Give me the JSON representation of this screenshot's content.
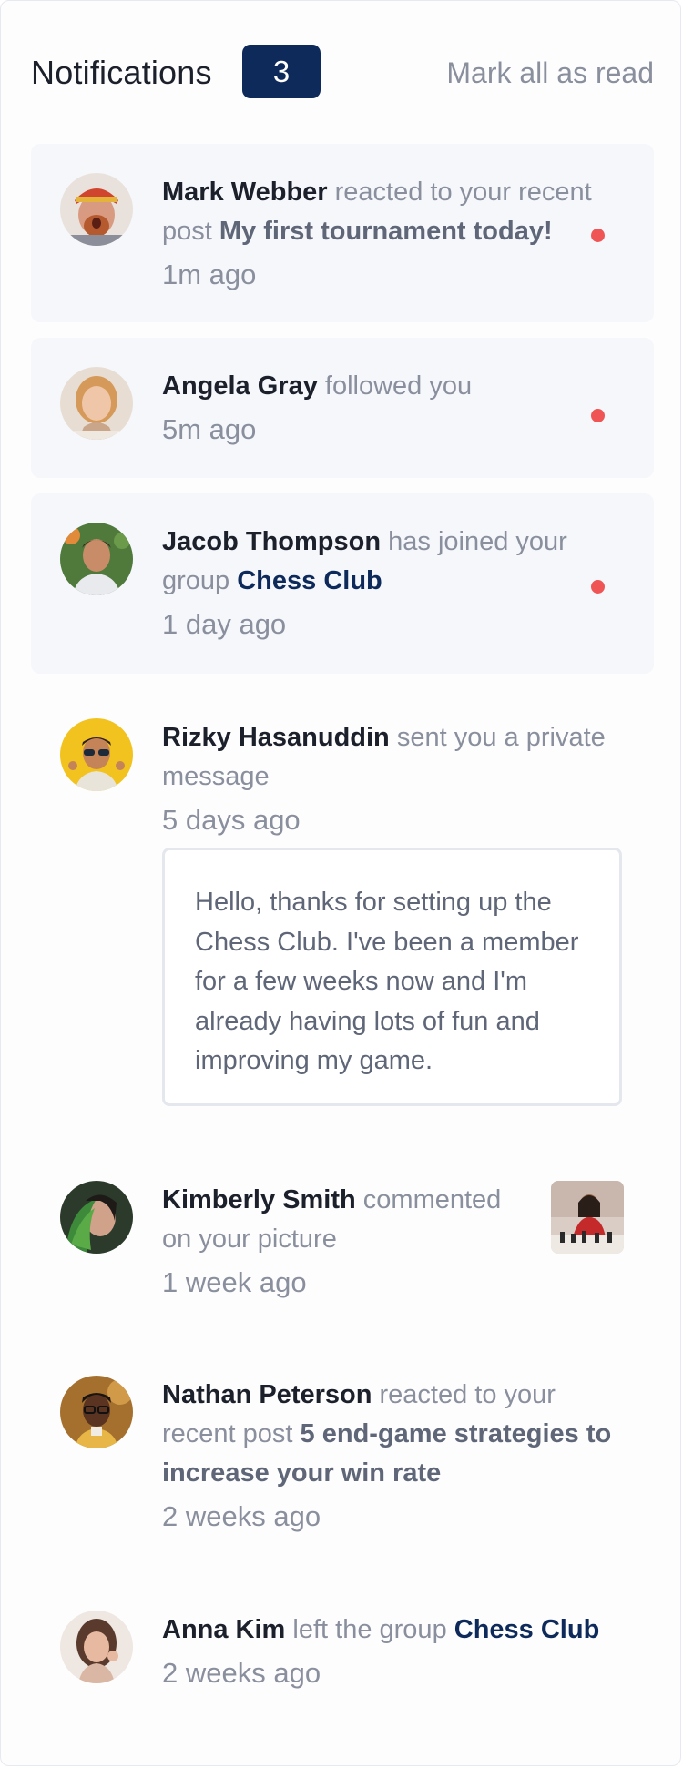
{
  "header": {
    "title": "Notifications",
    "unread_count": "3",
    "mark_all_label": "Mark all as read"
  },
  "notifications": [
    {
      "name": "Mark Webber",
      "action": "reacted to your recent post",
      "post": "My first tournament today!",
      "time": "1m ago",
      "unread": true
    },
    {
      "name": "Angela Gray",
      "action": "followed you",
      "time": "5m ago",
      "unread": true
    },
    {
      "name": "Jacob Thompson",
      "action": "has joined your group",
      "group": "Chess Club",
      "time": "1 day ago",
      "unread": true
    },
    {
      "name": "Rizky Hasanuddin",
      "action": "sent you a private message",
      "time": "5 days ago",
      "message": "Hello, thanks for setting up the Chess Club. I've been a member for a few weeks now and I'm already having lots of fun and improving my game.",
      "unread": false
    },
    {
      "name": "Kimberly Smith",
      "action": "commented on your picture",
      "time": "1 week ago",
      "unread": false
    },
    {
      "name": "Nathan Peterson",
      "action": "reacted to your recent post",
      "post": "5 end-game strategies to increase your win rate",
      "time": "2 weeks ago",
      "unread": false
    },
    {
      "name": "Anna Kim",
      "action": "left the group",
      "group": "Chess Club",
      "time": "2 weeks ago",
      "unread": false
    }
  ],
  "colors": {
    "unread_background": "#f5f7fb",
    "badge_background": "#0e2a5a",
    "unread_dot": "#f05555",
    "name_text": "#1c202b",
    "muted_text": "#8a8f9d",
    "group_link": "#0e2a5a"
  }
}
